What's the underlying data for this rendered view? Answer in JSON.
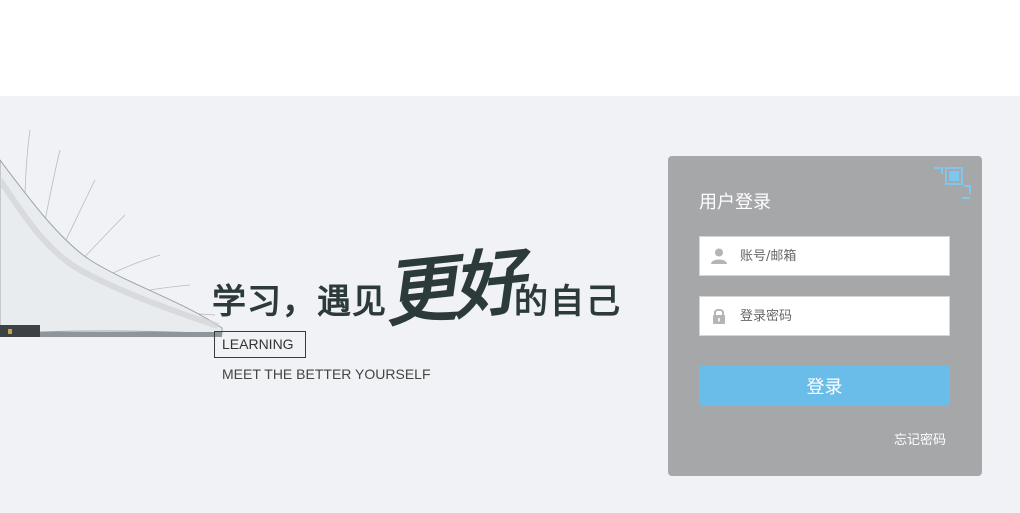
{
  "hero": {
    "slogan_part1": "学习，遇见",
    "slogan_part2": "更好",
    "slogan_part3": "的自己",
    "learning_label": "LEARNING",
    "tagline": "MEET THE BETTER YOURSELF"
  },
  "login": {
    "title": "用户登录",
    "username_placeholder": "账号/邮箱",
    "username_value": "",
    "password_placeholder": "登录密码",
    "password_value": "",
    "submit_label": "登录",
    "forgot_label": "忘记密码",
    "qr_icon": "qrcode-icon",
    "user_icon": "user-icon",
    "lock_icon": "lock-icon"
  },
  "colors": {
    "background": "#f0f2f5",
    "panel": "#a6a7a9",
    "accent": "#6bbde9",
    "slogan": "#2c3b3a"
  }
}
